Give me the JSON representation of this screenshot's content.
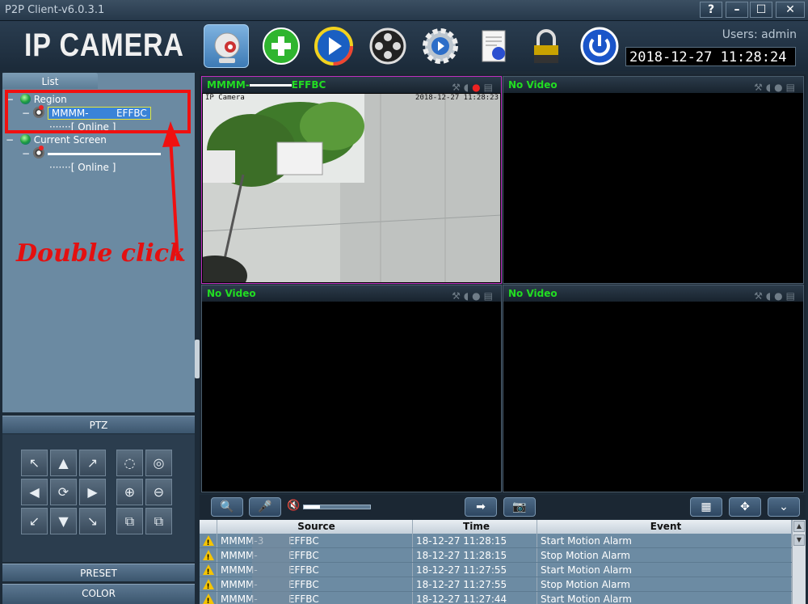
{
  "window": {
    "title": "P2P Client-v6.0.3.1",
    "help": "?",
    "minimize": "–",
    "maximize": "☐",
    "close": "✕"
  },
  "header": {
    "logo": "IP CAMERA",
    "users_label": "Users: admin",
    "clock": "2018-12-27 11:28:24"
  },
  "toolbar": [
    "monitor",
    "add-device",
    "playback",
    "record-settings",
    "settings",
    "log",
    "lock",
    "power"
  ],
  "left_panel": {
    "tab": "List",
    "tree": {
      "region": "Region",
      "device1": "MMMM-",
      "device1_suffix": "EFFBC",
      "status1": "[    Online    ]",
      "current_screen": "Current Screen",
      "status2": "[    Online    ]"
    },
    "annotation": "Double click",
    "sections": {
      "ptz": "PTZ",
      "preset": "PRESET",
      "color": "COLOR"
    }
  },
  "ptz_buttons": [
    "↖",
    "▲",
    "↗",
    "◀",
    "⟳",
    "▶",
    "↙",
    "▼",
    "↘"
  ],
  "ptz_extra": [
    "◌",
    "◎",
    "⊕",
    "⊖",
    "⧉",
    "⧉"
  ],
  "panes": [
    {
      "title": "MMMM-",
      "title_suffix": "EFFBC",
      "osd_left": "IP Camera",
      "osd_right": "2018-12-27 11:28:23"
    },
    {
      "title": "No Video"
    },
    {
      "title": "No Video"
    },
    {
      "title": "No Video"
    }
  ],
  "controls": {
    "zoom": "🔍",
    "mic": "🎤",
    "speaker": "🔇",
    "record": "➡",
    "snapshot": "📷",
    "grid": "▦",
    "fullscreen": "✥",
    "more": "⌄"
  },
  "events": {
    "headers": [
      "",
      "Source",
      "Time",
      "Event"
    ],
    "rows": [
      {
        "source": "MMMM-3",
        "source_suffix": "EFFBC",
        "time": "18-12-27 11:28:15",
        "event": "Start Motion Alarm"
      },
      {
        "source": "MMMM-",
        "source_suffix": "EFFBC",
        "time": "18-12-27 11:28:15",
        "event": "Stop Motion Alarm"
      },
      {
        "source": "MMMM-",
        "source_suffix": "EFFBC",
        "time": "18-12-27 11:27:55",
        "event": "Start Motion Alarm"
      },
      {
        "source": "MMMM-",
        "source_suffix": "EFFBC",
        "time": "18-12-27 11:27:55",
        "event": "Stop Motion Alarm"
      },
      {
        "source": "MMMM-",
        "source_suffix": "EFFBC",
        "time": "18-12-27 11:27:44",
        "event": "Start Motion Alarm"
      }
    ]
  }
}
